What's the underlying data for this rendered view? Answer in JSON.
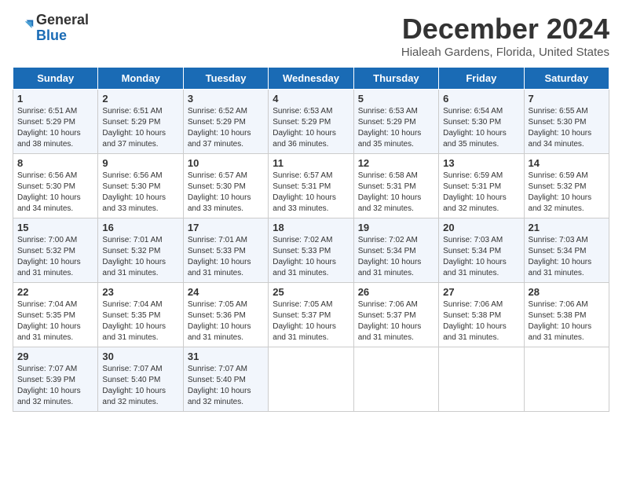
{
  "header": {
    "logo_line1": "General",
    "logo_line2": "Blue",
    "month": "December 2024",
    "location": "Hialeah Gardens, Florida, United States"
  },
  "days_of_week": [
    "Sunday",
    "Monday",
    "Tuesday",
    "Wednesday",
    "Thursday",
    "Friday",
    "Saturday"
  ],
  "weeks": [
    [
      {
        "day": "1",
        "sunrise": "6:51 AM",
        "sunset": "5:29 PM",
        "daylight": "10 hours and 38 minutes."
      },
      {
        "day": "2",
        "sunrise": "6:51 AM",
        "sunset": "5:29 PM",
        "daylight": "10 hours and 37 minutes."
      },
      {
        "day": "3",
        "sunrise": "6:52 AM",
        "sunset": "5:29 PM",
        "daylight": "10 hours and 37 minutes."
      },
      {
        "day": "4",
        "sunrise": "6:53 AM",
        "sunset": "5:29 PM",
        "daylight": "10 hours and 36 minutes."
      },
      {
        "day": "5",
        "sunrise": "6:53 AM",
        "sunset": "5:29 PM",
        "daylight": "10 hours and 35 minutes."
      },
      {
        "day": "6",
        "sunrise": "6:54 AM",
        "sunset": "5:30 PM",
        "daylight": "10 hours and 35 minutes."
      },
      {
        "day": "7",
        "sunrise": "6:55 AM",
        "sunset": "5:30 PM",
        "daylight": "10 hours and 34 minutes."
      }
    ],
    [
      {
        "day": "8",
        "sunrise": "6:56 AM",
        "sunset": "5:30 PM",
        "daylight": "10 hours and 34 minutes."
      },
      {
        "day": "9",
        "sunrise": "6:56 AM",
        "sunset": "5:30 PM",
        "daylight": "10 hours and 33 minutes."
      },
      {
        "day": "10",
        "sunrise": "6:57 AM",
        "sunset": "5:30 PM",
        "daylight": "10 hours and 33 minutes."
      },
      {
        "day": "11",
        "sunrise": "6:57 AM",
        "sunset": "5:31 PM",
        "daylight": "10 hours and 33 minutes."
      },
      {
        "day": "12",
        "sunrise": "6:58 AM",
        "sunset": "5:31 PM",
        "daylight": "10 hours and 32 minutes."
      },
      {
        "day": "13",
        "sunrise": "6:59 AM",
        "sunset": "5:31 PM",
        "daylight": "10 hours and 32 minutes."
      },
      {
        "day": "14",
        "sunrise": "6:59 AM",
        "sunset": "5:32 PM",
        "daylight": "10 hours and 32 minutes."
      }
    ],
    [
      {
        "day": "15",
        "sunrise": "7:00 AM",
        "sunset": "5:32 PM",
        "daylight": "10 hours and 31 minutes."
      },
      {
        "day": "16",
        "sunrise": "7:01 AM",
        "sunset": "5:32 PM",
        "daylight": "10 hours and 31 minutes."
      },
      {
        "day": "17",
        "sunrise": "7:01 AM",
        "sunset": "5:33 PM",
        "daylight": "10 hours and 31 minutes."
      },
      {
        "day": "18",
        "sunrise": "7:02 AM",
        "sunset": "5:33 PM",
        "daylight": "10 hours and 31 minutes."
      },
      {
        "day": "19",
        "sunrise": "7:02 AM",
        "sunset": "5:34 PM",
        "daylight": "10 hours and 31 minutes."
      },
      {
        "day": "20",
        "sunrise": "7:03 AM",
        "sunset": "5:34 PM",
        "daylight": "10 hours and 31 minutes."
      },
      {
        "day": "21",
        "sunrise": "7:03 AM",
        "sunset": "5:34 PM",
        "daylight": "10 hours and 31 minutes."
      }
    ],
    [
      {
        "day": "22",
        "sunrise": "7:04 AM",
        "sunset": "5:35 PM",
        "daylight": "10 hours and 31 minutes."
      },
      {
        "day": "23",
        "sunrise": "7:04 AM",
        "sunset": "5:35 PM",
        "daylight": "10 hours and 31 minutes."
      },
      {
        "day": "24",
        "sunrise": "7:05 AM",
        "sunset": "5:36 PM",
        "daylight": "10 hours and 31 minutes."
      },
      {
        "day": "25",
        "sunrise": "7:05 AM",
        "sunset": "5:37 PM",
        "daylight": "10 hours and 31 minutes."
      },
      {
        "day": "26",
        "sunrise": "7:06 AM",
        "sunset": "5:37 PM",
        "daylight": "10 hours and 31 minutes."
      },
      {
        "day": "27",
        "sunrise": "7:06 AM",
        "sunset": "5:38 PM",
        "daylight": "10 hours and 31 minutes."
      },
      {
        "day": "28",
        "sunrise": "7:06 AM",
        "sunset": "5:38 PM",
        "daylight": "10 hours and 31 minutes."
      }
    ],
    [
      {
        "day": "29",
        "sunrise": "7:07 AM",
        "sunset": "5:39 PM",
        "daylight": "10 hours and 32 minutes."
      },
      {
        "day": "30",
        "sunrise": "7:07 AM",
        "sunset": "5:40 PM",
        "daylight": "10 hours and 32 minutes."
      },
      {
        "day": "31",
        "sunrise": "7:07 AM",
        "sunset": "5:40 PM",
        "daylight": "10 hours and 32 minutes."
      },
      null,
      null,
      null,
      null
    ]
  ]
}
